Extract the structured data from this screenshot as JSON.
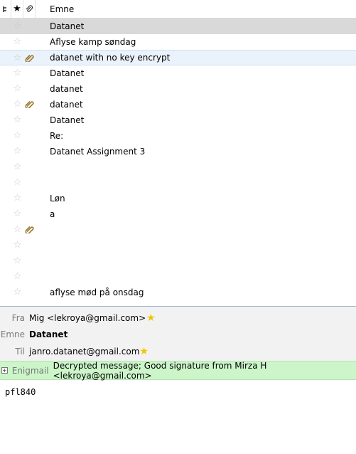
{
  "list": {
    "subject_header": "Emne",
    "rows": [
      {
        "subject": "Datanet",
        "attachment": false
      },
      {
        "subject": "Aflyse kamp søndag",
        "attachment": false
      },
      {
        "subject": "datanet with no key encrypt",
        "attachment": true
      },
      {
        "subject": "Datanet",
        "attachment": false
      },
      {
        "subject": "datanet",
        "attachment": false
      },
      {
        "subject": "datanet",
        "attachment": true
      },
      {
        "subject": "Datanet",
        "attachment": false
      },
      {
        "subject": "Re:",
        "attachment": false
      },
      {
        "subject": "Datanet Assignment 3",
        "attachment": false
      },
      {
        "subject": "",
        "attachment": false
      },
      {
        "subject": "",
        "attachment": false
      },
      {
        "subject": "Løn",
        "attachment": false
      },
      {
        "subject": "a",
        "attachment": false
      },
      {
        "subject": "",
        "attachment": true
      },
      {
        "subject": "",
        "attachment": false
      },
      {
        "subject": "",
        "attachment": false
      },
      {
        "subject": "",
        "attachment": false
      },
      {
        "subject": "aflyse mød på onsdag",
        "attachment": false
      }
    ]
  },
  "message": {
    "from_label": "Fra",
    "from_value": "Mig <lekroya@gmail.com>",
    "subject_label": "Emne",
    "subject_value": "Datanet",
    "to_label": "Til",
    "to_value": "janro.datanet@gmail.com",
    "enigmail_label": "Enigmail",
    "enigmail_status": "Decrypted message; Good signature from Mirza H <lekroya@gmail.com>",
    "body": "pfl840"
  },
  "colors": {
    "selected_row": "#d9d9d9",
    "highlight_row": "#eaf2fb",
    "enigmail_bar": "#ccf6c9",
    "star_yellow": "#f2c200"
  }
}
